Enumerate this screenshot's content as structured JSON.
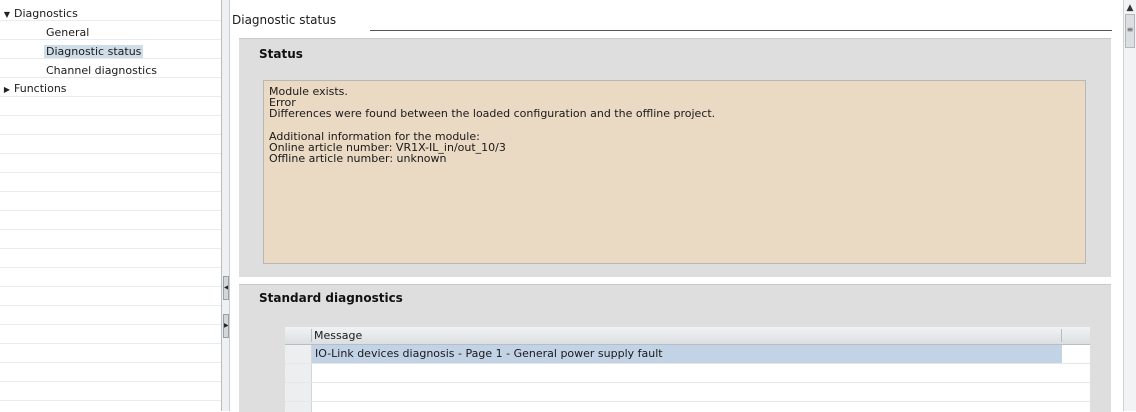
{
  "nav": {
    "items": [
      {
        "label": "Diagnostics",
        "expanded": true,
        "arrow": "▼"
      },
      {
        "label": "General"
      },
      {
        "label": "Diagnostic status",
        "selected": true
      },
      {
        "label": "Channel diagnostics"
      },
      {
        "label": "Functions",
        "expanded": false,
        "arrow": "▶"
      }
    ]
  },
  "splitter": {
    "collapse_icon": "◀",
    "expand_icon": "▶"
  },
  "section": {
    "title": "Diagnostic status"
  },
  "status": {
    "title": "Status",
    "lines": [
      "Module exists.",
      "Error",
      "Differences were found between the loaded configuration and the offline project.",
      "",
      "Additional information for the module:",
      "Online article number:  VR1X-IL_in/out_10/3",
      "Offline article number:  unknown"
    ],
    "background_color": "#ead9c3"
  },
  "standard_diagnostics": {
    "title": "Standard diagnostics",
    "table": {
      "columns": [
        "Message"
      ],
      "rows": [
        {
          "message": "IO-Link devices diagnosis - Page 1 - General power supply fault",
          "selected": true
        },
        {
          "message": ""
        },
        {
          "message": ""
        },
        {
          "message": ""
        }
      ]
    }
  },
  "scrollbar": {
    "up_icon": "▲",
    "thumb_icon": "≡"
  }
}
